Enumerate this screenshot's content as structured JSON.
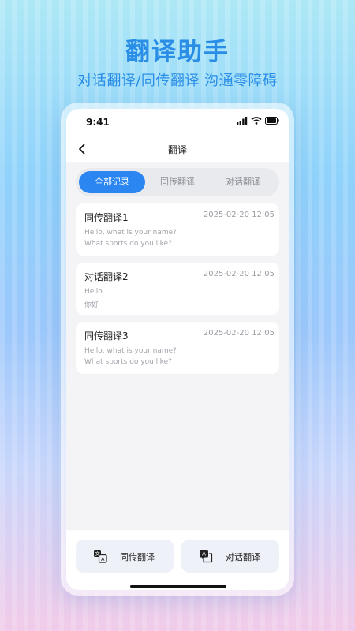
{
  "promo": {
    "title": "翻译助手",
    "subtitle": "对话翻译/同传翻译 沟通零障碍"
  },
  "status_bar": {
    "time": "9:41",
    "icons": [
      "signal-icon",
      "wifi-icon",
      "battery-icon"
    ]
  },
  "nav": {
    "title": "翻译",
    "back_icon": "chevron-left-icon"
  },
  "tabs": [
    {
      "label": "全部记录",
      "active": true
    },
    {
      "label": "同传翻译",
      "active": false
    },
    {
      "label": "对话翻译",
      "active": false
    }
  ],
  "records": [
    {
      "title": "同传翻译1",
      "time": "2025-02-20  12:05",
      "lines": [
        "Hello, what is your name?",
        "What sports do you like?"
      ]
    },
    {
      "title": "对话翻译2",
      "time": "2025-02-20  12:05",
      "lines": [
        "Hello",
        "你好"
      ]
    },
    {
      "title": "同传翻译3",
      "time": "2025-02-20  12:05",
      "lines": [
        "Hello, what is your name?",
        "What sports do you like?"
      ]
    }
  ],
  "bottom_actions": [
    {
      "label": "同传翻译",
      "icon": "simultaneous-translate-icon"
    },
    {
      "label": "对话翻译",
      "icon": "dialogue-translate-icon"
    }
  ],
  "colors": {
    "accent": "#2b86f2",
    "headline": "#2a8ee6",
    "screen_bg": "#f4f4f6"
  }
}
